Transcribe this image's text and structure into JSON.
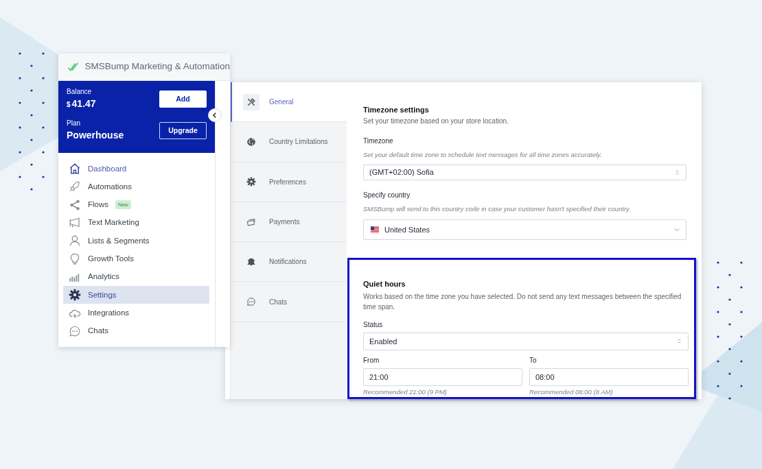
{
  "app": {
    "title": "SMSBump Marketing & Automation"
  },
  "account": {
    "balance_label": "Balance",
    "currency": "$",
    "balance": "41.47",
    "add_button": "Add",
    "plan_label": "Plan",
    "plan": "Powerhouse",
    "upgrade_button": "Upgrade"
  },
  "sidebar": {
    "items": [
      {
        "label": "Dashboard",
        "highlighted": true,
        "selected": false
      },
      {
        "label": "Automations",
        "highlighted": false,
        "selected": false
      },
      {
        "label": "Flows",
        "highlighted": false,
        "selected": false,
        "badge": "New"
      },
      {
        "label": "Text Marketing",
        "highlighted": false,
        "selected": false
      },
      {
        "label": "Lists & Segments",
        "highlighted": false,
        "selected": false
      },
      {
        "label": "Growth Tools",
        "highlighted": false,
        "selected": false
      },
      {
        "label": "Analytics",
        "highlighted": false,
        "selected": false
      },
      {
        "label": "Settings",
        "highlighted": false,
        "selected": true
      },
      {
        "label": "Integrations",
        "highlighted": false,
        "selected": false
      },
      {
        "label": "Chats",
        "highlighted": false,
        "selected": false
      }
    ]
  },
  "settings_tabs": [
    {
      "label": "General",
      "selected": true
    },
    {
      "label": "Country Limitations",
      "selected": false
    },
    {
      "label": "Preferences",
      "selected": false
    },
    {
      "label": "Payments",
      "selected": false
    },
    {
      "label": "Notifications",
      "selected": false
    },
    {
      "label": "Chats",
      "selected": false
    }
  ],
  "timezone_settings": {
    "title": "Timezone settings",
    "description": "Set your timezone based on your store location.",
    "timezone": {
      "label": "Timezone",
      "hint": "Set your default time zone to schedule text messages for all time zones accurately.",
      "value": "(GMT+02:00) Sofia"
    },
    "country": {
      "label": "Specify country",
      "hint": "SMSBump will send to this country code in case your customer hasn't specified their country.",
      "value": "United States"
    }
  },
  "quiet_hours": {
    "title": "Quiet hours",
    "description": "Works based on the time zone you have selected. Do not send any text messages between the specified time span.",
    "status": {
      "label": "Status",
      "value": "Enabled"
    },
    "from": {
      "label": "From",
      "value": "21:00",
      "hint": "Recommended 21:00 (9 PM)"
    },
    "to": {
      "label": "To",
      "value": "08:00",
      "hint": "Recommended 08:00 (8 AM)"
    }
  }
}
